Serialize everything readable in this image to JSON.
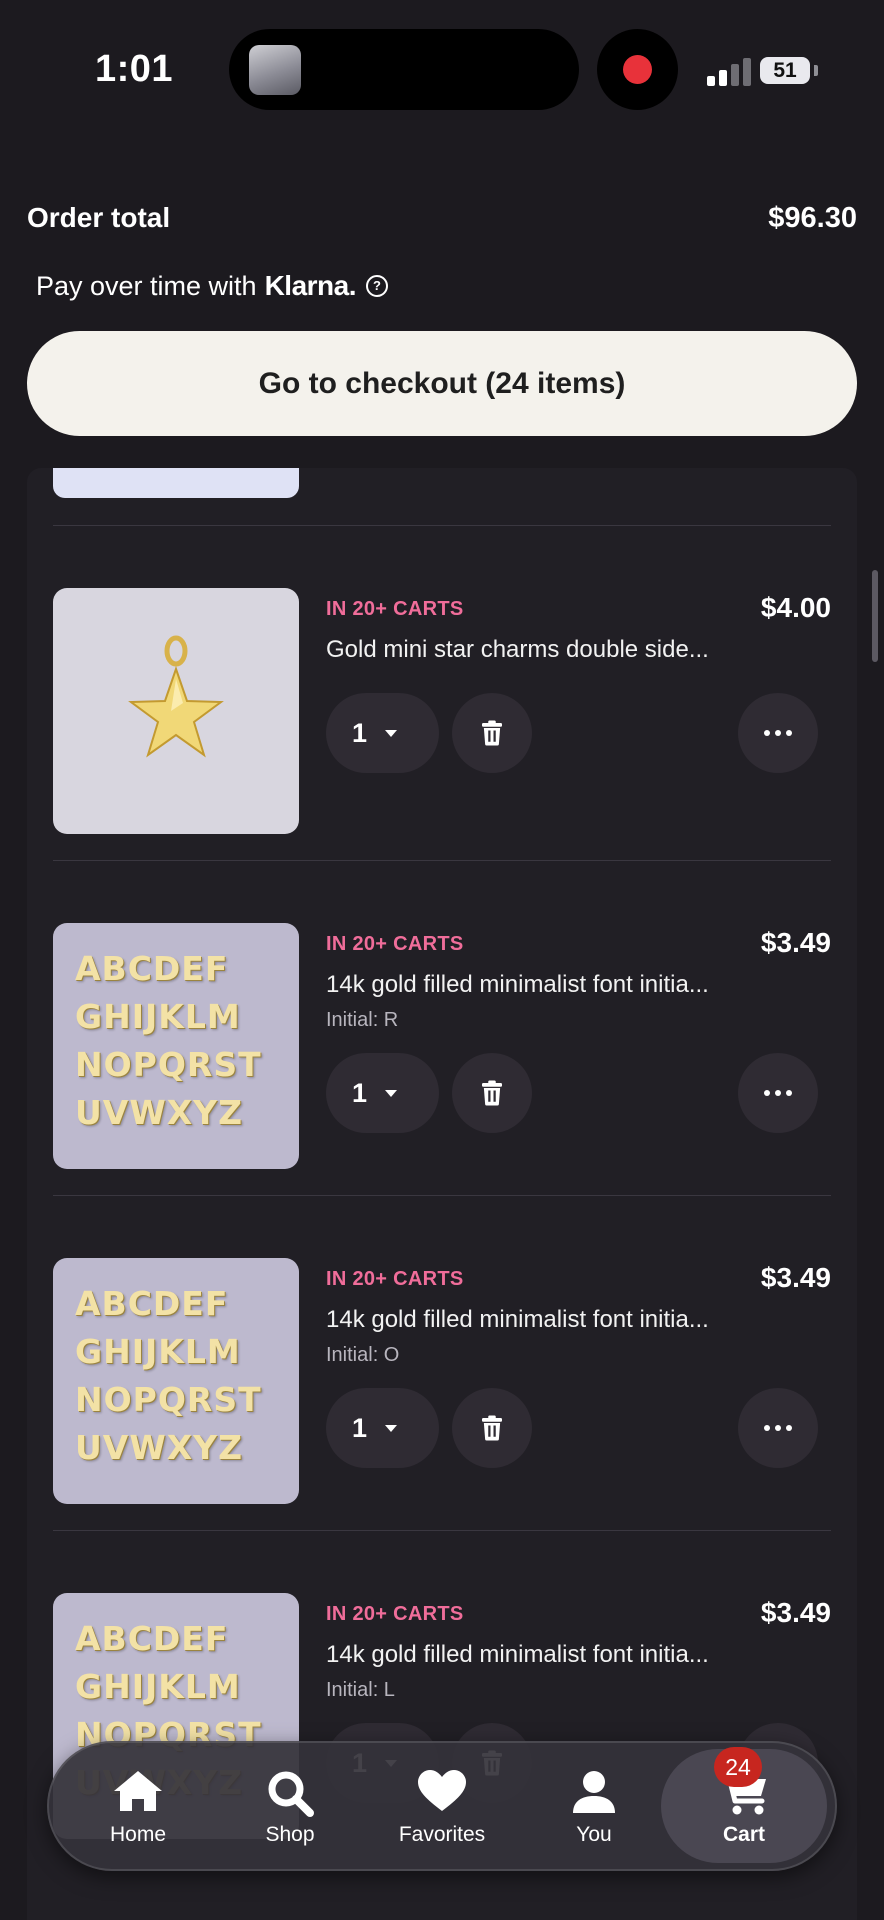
{
  "status_bar": {
    "time": "1:01",
    "battery": "51",
    "icons": [
      "media-thumbnail-icon",
      "record-icon",
      "signal-icon",
      "battery-icon"
    ]
  },
  "order": {
    "total_label": "Order total",
    "total_value": "$96.30",
    "klarna_prefix": "Pay over time with",
    "klarna_brand": "Klarna.",
    "info_glyph": "?"
  },
  "checkout": {
    "label": "Go to checkout (24 items)"
  },
  "items": [
    {
      "badge": "IN 20+ CARTS",
      "title": "Gold mini star charms double side...",
      "price": "$4.00",
      "variant": "",
      "quantity": "1",
      "image": "gold-star-charm"
    },
    {
      "badge": "IN 20+ CARTS",
      "title": "14k gold filled minimalist font initia...",
      "price": "$3.49",
      "variant": "Initial: R",
      "quantity": "1",
      "image": "letter-charms"
    },
    {
      "badge": "IN 20+ CARTS",
      "title": "14k gold filled minimalist font initia...",
      "price": "$3.49",
      "variant": "Initial: O",
      "quantity": "1",
      "image": "letter-charms"
    },
    {
      "badge": "IN 20+ CARTS",
      "title": "14k gold filled minimalist font initia...",
      "price": "$3.49",
      "variant": "Initial: L",
      "quantity": "1",
      "image": "letter-charms"
    }
  ],
  "tabs": [
    {
      "label": "Home",
      "icon": "home-icon"
    },
    {
      "label": "Shop",
      "icon": "search-icon"
    },
    {
      "label": "Favorites",
      "icon": "heart-icon"
    },
    {
      "label": "You",
      "icon": "person-icon"
    },
    {
      "label": "Cart",
      "icon": "cart-icon",
      "active": true,
      "badge": "24"
    }
  ],
  "colors": {
    "background": "#1c1a1f",
    "badge_pink": "#f06d9a",
    "checkout_button": "#f4f2ec",
    "cart_badge": "#c7261f",
    "record": "#e8323a"
  }
}
